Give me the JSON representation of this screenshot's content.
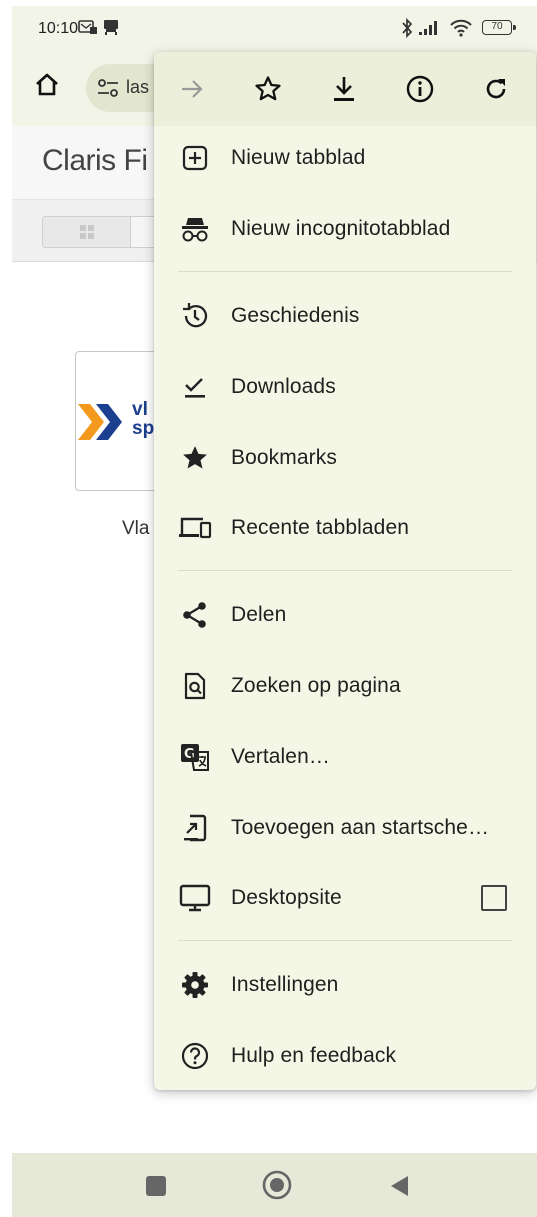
{
  "status_bar": {
    "time": "10:10",
    "battery": "70"
  },
  "toolbar": {
    "url_text": "las"
  },
  "page": {
    "title": "Claris Fi",
    "card_logo_line1": "vl",
    "card_logo_line2": "sp",
    "card_label": "Vla"
  },
  "menu": {
    "items": [
      {
        "label": "Nieuw tabblad",
        "icon": "new-tab-icon"
      },
      {
        "label": "Nieuw incognitotabblad",
        "icon": "incognito-icon"
      },
      {
        "label": "Geschiedenis",
        "icon": "history-icon"
      },
      {
        "label": "Downloads",
        "icon": "downloads-icon"
      },
      {
        "label": "Bookmarks",
        "icon": "star-filled-icon"
      },
      {
        "label": "Recente tabbladen",
        "icon": "devices-icon"
      },
      {
        "label": "Delen",
        "icon": "share-icon"
      },
      {
        "label": "Zoeken op pagina",
        "icon": "find-in-page-icon"
      },
      {
        "label": "Vertalen…",
        "icon": "translate-icon"
      },
      {
        "label": "Toevoegen aan startsche…",
        "icon": "add-to-home-icon"
      },
      {
        "label": "Desktopsite",
        "icon": "desktop-icon",
        "checked": false
      },
      {
        "label": "Instellingen",
        "icon": "settings-icon"
      },
      {
        "label": "Hulp en feedback",
        "icon": "help-icon"
      }
    ]
  },
  "colors": {
    "chrome_bg": "#f2f4e8",
    "menu_bg": "#f5f7e6",
    "omnibox_bg": "#e3e6cf",
    "logo_orange": "#f39a1e",
    "logo_blue": "#1d3f8f"
  }
}
